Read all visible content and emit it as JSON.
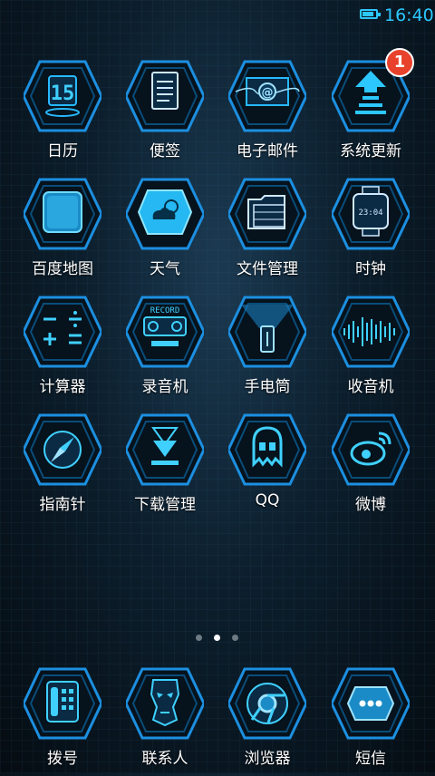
{
  "status": {
    "time": "16:40",
    "battery_level": 0.85
  },
  "apps": [
    {
      "label": "日历",
      "icon": "calendar-icon",
      "glyph": "15"
    },
    {
      "label": "便签",
      "icon": "notes-icon",
      "glyph": ""
    },
    {
      "label": "电子邮件",
      "icon": "email-icon",
      "glyph": "@"
    },
    {
      "label": "系统更新",
      "icon": "system-update-icon",
      "glyph": "",
      "badge": "1"
    },
    {
      "label": "百度地图",
      "icon": "map-icon",
      "glyph": ""
    },
    {
      "label": "天气",
      "icon": "weather-icon",
      "glyph": ""
    },
    {
      "label": "文件管理",
      "icon": "folder-icon",
      "glyph": ""
    },
    {
      "label": "时钟",
      "icon": "clock-icon",
      "glyph": "23:04"
    },
    {
      "label": "计算器",
      "icon": "calculator-icon",
      "glyph": ""
    },
    {
      "label": "录音机",
      "icon": "recorder-icon",
      "glyph": "RECORD"
    },
    {
      "label": "手电筒",
      "icon": "flashlight-icon",
      "glyph": ""
    },
    {
      "label": "收音机",
      "icon": "radio-icon",
      "glyph": ""
    },
    {
      "label": "指南针",
      "icon": "compass-icon",
      "glyph": ""
    },
    {
      "label": "下载管理",
      "icon": "download-icon",
      "glyph": ""
    },
    {
      "label": "QQ",
      "icon": "qq-icon",
      "glyph": ""
    },
    {
      "label": "微博",
      "icon": "weibo-icon",
      "glyph": ""
    }
  ],
  "page_indicator": {
    "count": 3,
    "active": 2
  },
  "dock": [
    {
      "label": "拨号",
      "icon": "phone-icon"
    },
    {
      "label": "联系人",
      "icon": "contacts-icon"
    },
    {
      "label": "浏览器",
      "icon": "browser-icon"
    },
    {
      "label": "短信",
      "icon": "sms-icon"
    }
  ],
  "colors": {
    "accent": "#2cc7ff",
    "badge": "#e8412c"
  }
}
